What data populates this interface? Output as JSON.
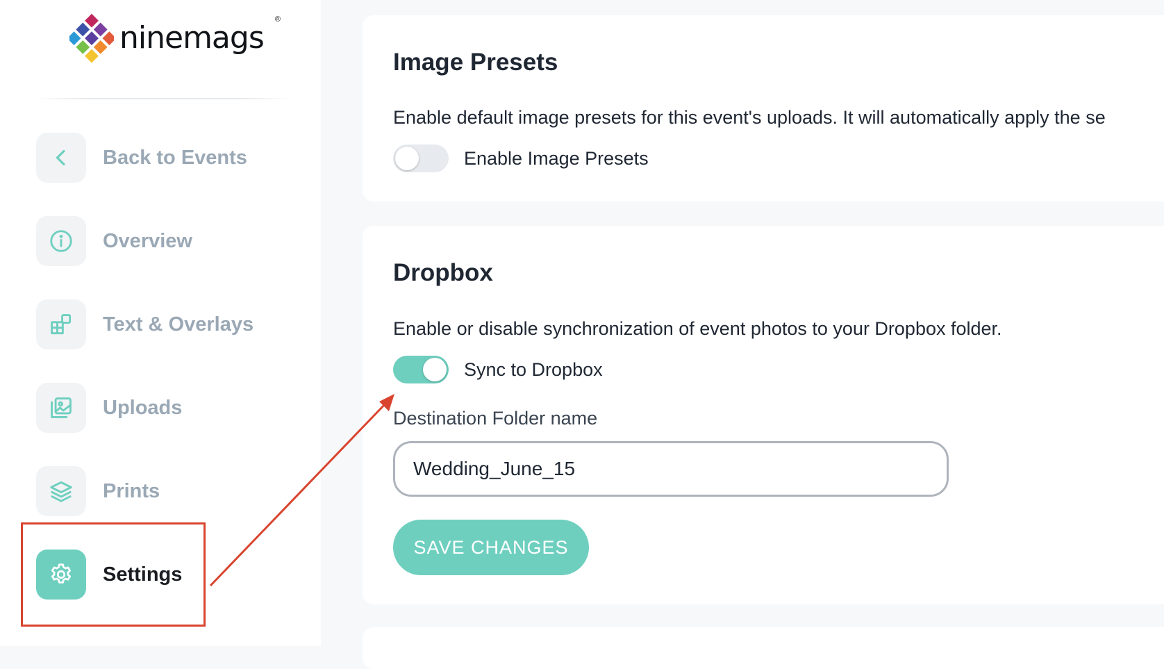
{
  "brand": {
    "name": "ninemags",
    "registered_mark": "®"
  },
  "sidebar": {
    "items": [
      {
        "label": "Back to Events",
        "icon": "chevron-left-icon",
        "active": false
      },
      {
        "label": "Overview",
        "icon": "info-circle-icon",
        "active": false
      },
      {
        "label": "Text & Overlays",
        "icon": "layout-blocks-icon",
        "active": false
      },
      {
        "label": "Uploads",
        "icon": "image-gallery-icon",
        "active": false
      },
      {
        "label": "Prints",
        "icon": "layers-icon",
        "active": false
      },
      {
        "label": "Settings",
        "icon": "gear-icon",
        "active": true
      }
    ]
  },
  "presets": {
    "title": "Image Presets",
    "description": "Enable default image presets for this event's uploads. It will automatically apply the se",
    "toggle_label": "Enable Image Presets",
    "enabled": false
  },
  "dropbox": {
    "title": "Dropbox",
    "description": "Enable or disable synchronization of event photos to your Dropbox folder.",
    "toggle_label": "Sync to Dropbox",
    "enabled": true,
    "folder_label": "Destination Folder name",
    "folder_value": "Wedding_June_15",
    "save_label": "SAVE CHANGES"
  },
  "colors": {
    "accent": "#6ecfbf",
    "annotation": "#d9442e",
    "muted_text": "#9aa8b5"
  }
}
